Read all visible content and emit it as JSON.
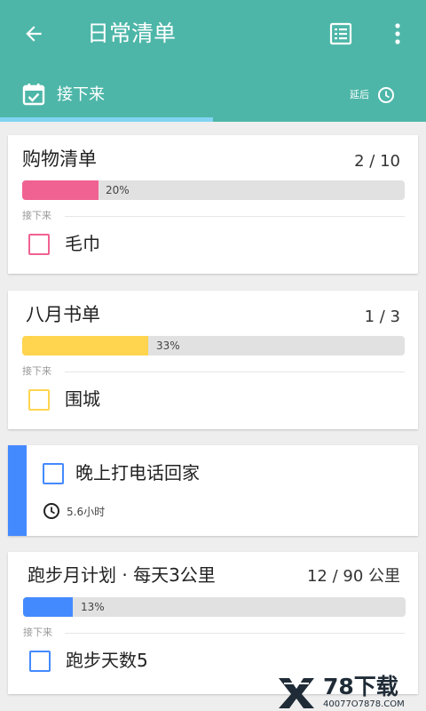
{
  "toolbar": {
    "title": "日常清单"
  },
  "tabs": {
    "next_label": "接下来",
    "later_label": "延后"
  },
  "colors": {
    "appbar": "#4db6a8",
    "tab_indicator": "#80d4f2",
    "pink": "#f06292",
    "yellow": "#ffd54f",
    "blue": "#448aff"
  },
  "cards": [
    {
      "title": "购物清单",
      "count": "2 / 10",
      "progress": 0.2,
      "progress_text": "20%",
      "section_label": "接下来",
      "item": "毛巾",
      "color": "#f06292"
    },
    {
      "title": "八月书单",
      "count": "1 / 3",
      "progress": 0.33,
      "progress_text": "33%",
      "section_label": "接下来",
      "item": "围城",
      "color": "#ffd54f"
    },
    {
      "task": "晚上打电话回家",
      "duration": "5.6小时",
      "color": "#448aff"
    },
    {
      "title": "跑步月计划 · 每天3公里",
      "count": "12 / 90 公里",
      "progress": 0.13,
      "progress_text": "13%",
      "section_label": "接下来",
      "item": "跑步天数5",
      "color": "#448aff"
    }
  ],
  "watermark": {
    "brand": "78下载",
    "url": "40077O7878.COM"
  }
}
